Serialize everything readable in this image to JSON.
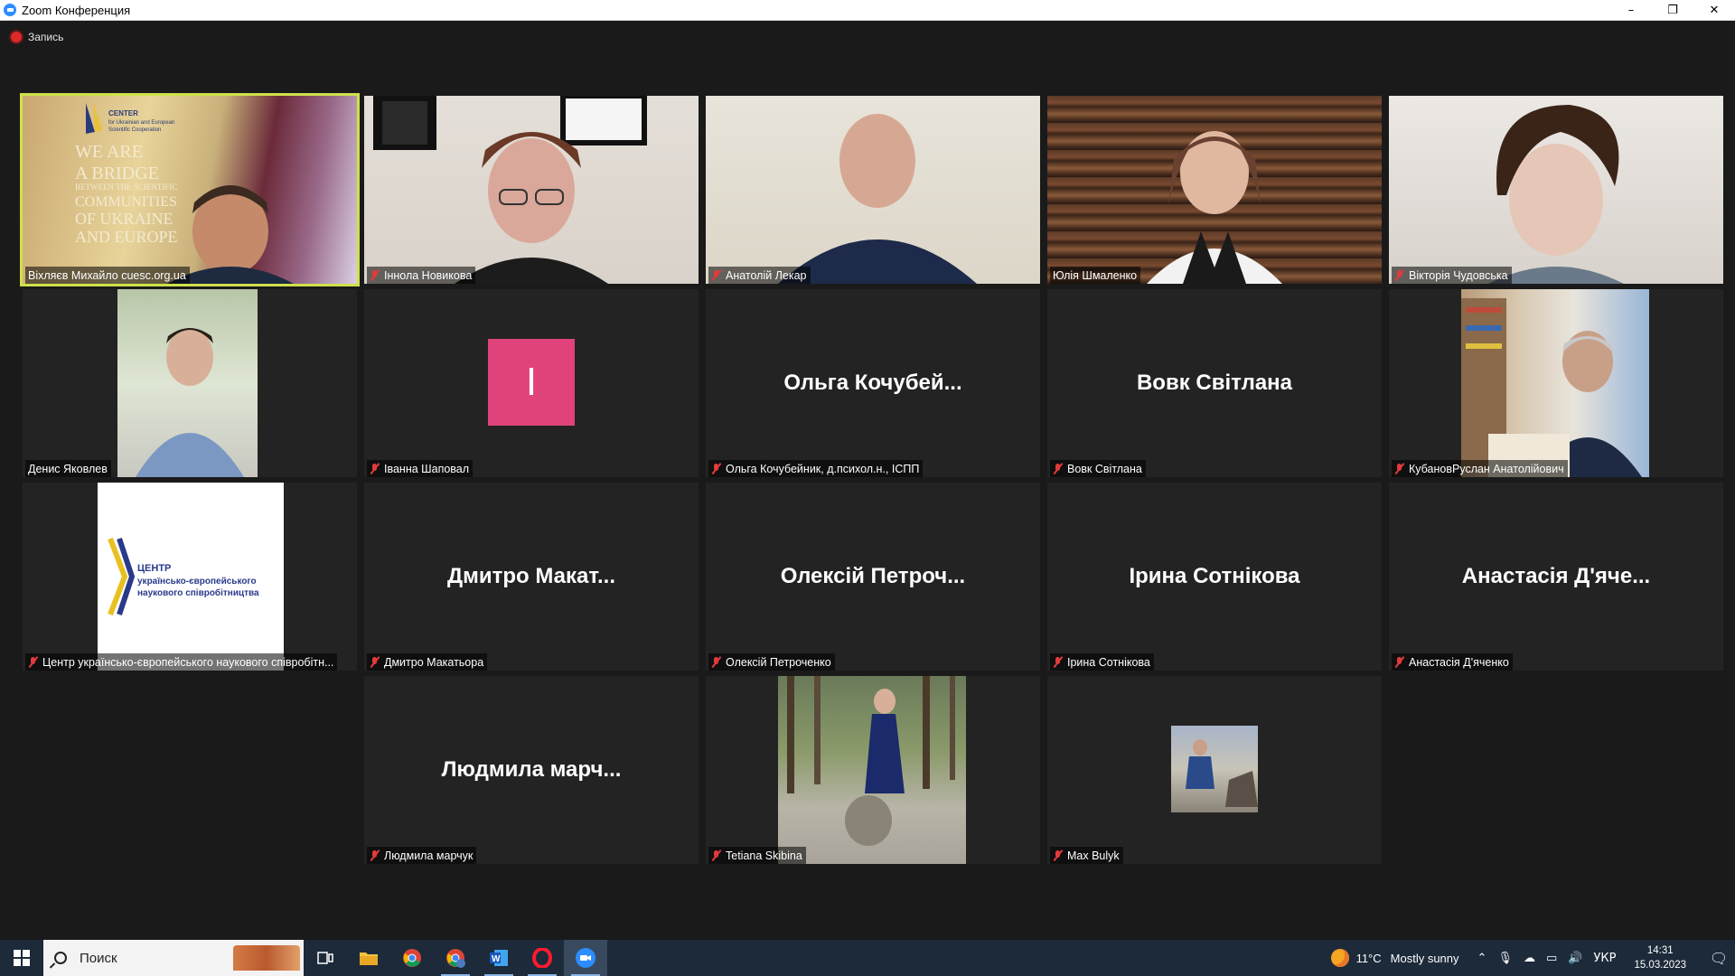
{
  "window": {
    "title": "Zoom Конференция",
    "controls": [
      "–",
      "❐",
      "✕"
    ]
  },
  "recording": {
    "label": "Запись"
  },
  "participants": [
    {
      "name": "Віхляєв Михайло cuesc.org.ua",
      "muted": false,
      "display": "video",
      "active": true
    },
    {
      "name": "Іннола Новикова",
      "muted": true,
      "display": "video"
    },
    {
      "name": "Анатолій Лекар",
      "muted": true,
      "display": "video"
    },
    {
      "name": "Юлія Шмаленко",
      "muted": false,
      "display": "video"
    },
    {
      "name": "Вікторія Чудовська",
      "muted": true,
      "display": "video"
    },
    {
      "name": "Денис Яковлев",
      "muted": false,
      "display": "video"
    },
    {
      "name": "Іванна Шаповал",
      "muted": true,
      "display": "avatar",
      "avatar_letter": "I",
      "avatar_color": "#e0437c"
    },
    {
      "name": "Ольга Кочубейник, д.психол.н., ІСПП",
      "muted": true,
      "display": "name",
      "big_name": "Ольга  Кочубей..."
    },
    {
      "name": "Вовк Світлана",
      "muted": true,
      "display": "name",
      "big_name": "Вовк Світлана"
    },
    {
      "name": "КубановРуслан Анатолійович",
      "muted": true,
      "display": "video"
    },
    {
      "name": "Центр українсько-європейського наукового співробітн...",
      "muted": true,
      "display": "logo",
      "logo_title": "ЦЕНТР",
      "logo_line1": "українсько-європейського",
      "logo_line2": "наукового співробітництва"
    },
    {
      "name": "Дмитро Макатьора",
      "muted": true,
      "display": "name",
      "big_name": "Дмитро  Макат..."
    },
    {
      "name": "Олексій Петроченко",
      "muted": true,
      "display": "name",
      "big_name": "Олексій  Петроч..."
    },
    {
      "name": "Ірина Сотнікова",
      "muted": true,
      "display": "name",
      "big_name": "Ірина Сотнікова"
    },
    {
      "name": "Анастасія Д'яченко",
      "muted": true,
      "display": "name",
      "big_name": "Анастасія  Д'яче..."
    },
    {
      "name": "Людмила марчук",
      "muted": true,
      "display": "name",
      "big_name": "Людмила  марч..."
    },
    {
      "name": "Tetiana Skibina",
      "muted": true,
      "display": "photo"
    },
    {
      "name": "Max Bulyk",
      "muted": true,
      "display": "photo-small"
    }
  ],
  "banner_lines": [
    "CENTER",
    "for Ukrainian and European",
    "Scientific Cooperation",
    "WE ARE",
    "A BRIDGE",
    "BETWEEN THE SCIENTIFIC",
    "COMMUNITIES",
    "OF UKRAINE",
    "AND EUROPE"
  ],
  "taskbar": {
    "search_placeholder": "Поиск",
    "apps": [
      "task-view",
      "file-explorer",
      "chrome",
      "chrome-profile",
      "word",
      "opera",
      "zoom"
    ],
    "weather_temp": "11°C",
    "weather_text": "Mostly sunny",
    "language": "УКР",
    "time": "14:31",
    "date": "15.03.2023"
  },
  "colors": {
    "active_speaker": "#cfe04a",
    "mute": "#e23b3b",
    "avatar_bg": "#e0437c",
    "tile_bg": "#232323"
  }
}
